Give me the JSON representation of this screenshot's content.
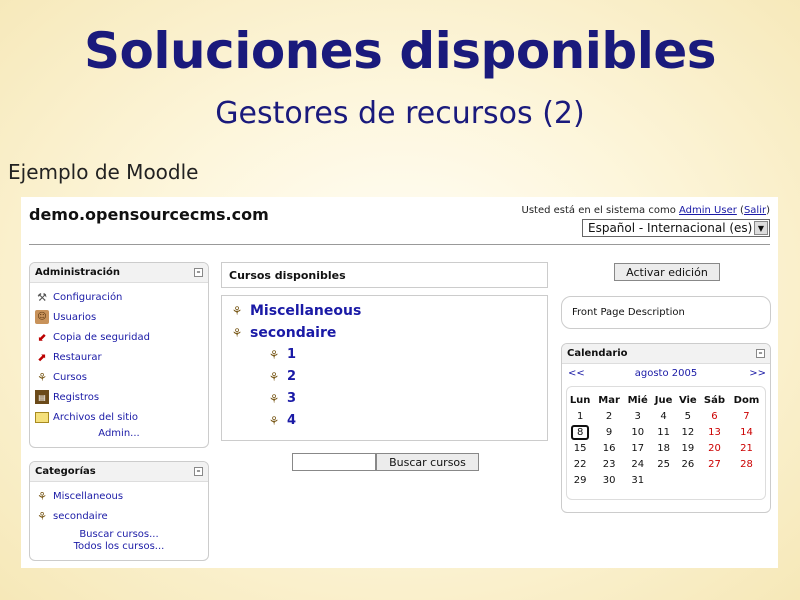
{
  "slide": {
    "title": "Soluciones disponibles",
    "subtitle": "Gestores de recursos (2)",
    "caption": "Ejemplo de Moodle"
  },
  "site": {
    "name": "demo.opensourcecms.com",
    "login_prefix": "Usted está en el sistema como ",
    "login_user": "Admin User",
    "login_open_paren": " (",
    "logout": "Salir",
    "login_close_paren": ")",
    "language": "Español - Internacional (es)"
  },
  "admin_block": {
    "title": "Administración",
    "collapse": "–",
    "items": [
      {
        "label": "Configuración",
        "icon": "hammer-icon"
      },
      {
        "label": "Usuarios",
        "icon": "users-icon"
      },
      {
        "label": "Copia de seguridad",
        "icon": "backup-icon"
      },
      {
        "label": "Restaurar",
        "icon": "restore-icon"
      },
      {
        "label": "Cursos",
        "icon": "course-icon"
      },
      {
        "label": "Registros",
        "icon": "logs-icon"
      },
      {
        "label": "Archivos del sitio",
        "icon": "folder-icon"
      }
    ],
    "more": "Admin..."
  },
  "categories_block": {
    "title": "Categorías",
    "collapse": "–",
    "items": [
      "Miscellaneous",
      "secondaire"
    ],
    "search_link": "Buscar cursos...",
    "all_link": "Todos los cursos..."
  },
  "courses": {
    "header": "Cursos disponibles",
    "categories": [
      "Miscellaneous",
      "secondaire"
    ],
    "subcourses": [
      "1",
      "2",
      "3",
      "4"
    ],
    "search_button": "Buscar cursos"
  },
  "right": {
    "edit_button": "Activar edición",
    "front_page_description": "Front Page Description"
  },
  "calendar": {
    "title": "Calendario",
    "collapse": "–",
    "prev": "<<",
    "month": "agosto 2005",
    "next": ">>",
    "weekdays": [
      "Lun",
      "Mar",
      "Mié",
      "Jue",
      "Vie",
      "Sáb",
      "Dom"
    ],
    "weeks": [
      [
        "1",
        "2",
        "3",
        "4",
        "5",
        "6",
        "7"
      ],
      [
        "8",
        "9",
        "10",
        "11",
        "12",
        "13",
        "14"
      ],
      [
        "15",
        "16",
        "17",
        "18",
        "19",
        "20",
        "21"
      ],
      [
        "22",
        "23",
        "24",
        "25",
        "26",
        "27",
        "28"
      ],
      [
        "29",
        "30",
        "31",
        "",
        "",
        "",
        ""
      ]
    ],
    "today": "8",
    "weekend_color": "#cc0000"
  },
  "colors": {
    "title": "#1a1a7c",
    "link": "#1a1aa6"
  }
}
